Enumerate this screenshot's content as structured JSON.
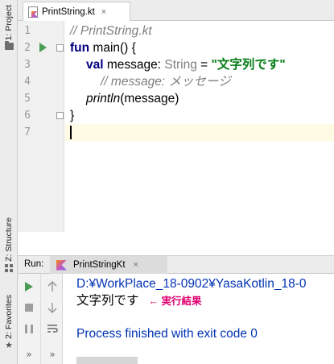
{
  "sidebar": {
    "project_tab": "1: Project",
    "structure_tab": "Z: Structure",
    "favorites_tab": "2: Favorites"
  },
  "editor": {
    "tab": {
      "label": "PrintString.kt",
      "close": "×",
      "icon": "kotlin-file-icon"
    },
    "line_numbers": [
      "1",
      "2",
      "3",
      "4",
      "5",
      "6",
      "7"
    ],
    "code": {
      "line1_comment": "// PrintString.kt",
      "line2_kw": "fun",
      "line2_rest": " main() {",
      "line3_kw": "val",
      "line3_name": " message: ",
      "line3_type": "String",
      "line3_eq": " = ",
      "line3_str": "\"文字列です\"",
      "line4_comment": "// message: メッセージ",
      "line5_fn": "println",
      "line5_rest": "(message)",
      "line6": "}"
    },
    "colors": {
      "keyword": "#000080",
      "string": "#067d17",
      "comment": "#808080",
      "current_line": "#fffae3"
    }
  },
  "run_panel": {
    "label": "Run:",
    "tab_label": "PrintStringKt",
    "tab_close": "×",
    "icons": {
      "rerun": "run-icon",
      "stop": "stop-icon",
      "pause": "pause-icon",
      "up": "arrow-up-icon",
      "down": "arrow-down-icon",
      "soft_wrap": "soft-wrap-icon",
      "more": "more-icon"
    },
    "more_glyph": "»",
    "console": {
      "path_line": "D:¥WorkPlace_18-0902¥YasaKotlin_18-0",
      "output_line": "文字列です",
      "annotation": "← 実行結果",
      "exit_line": "Process finished with exit code 0"
    },
    "colors": {
      "system": "#0033b3",
      "annotation": "#e0006f",
      "run_green": "#499c54"
    }
  }
}
